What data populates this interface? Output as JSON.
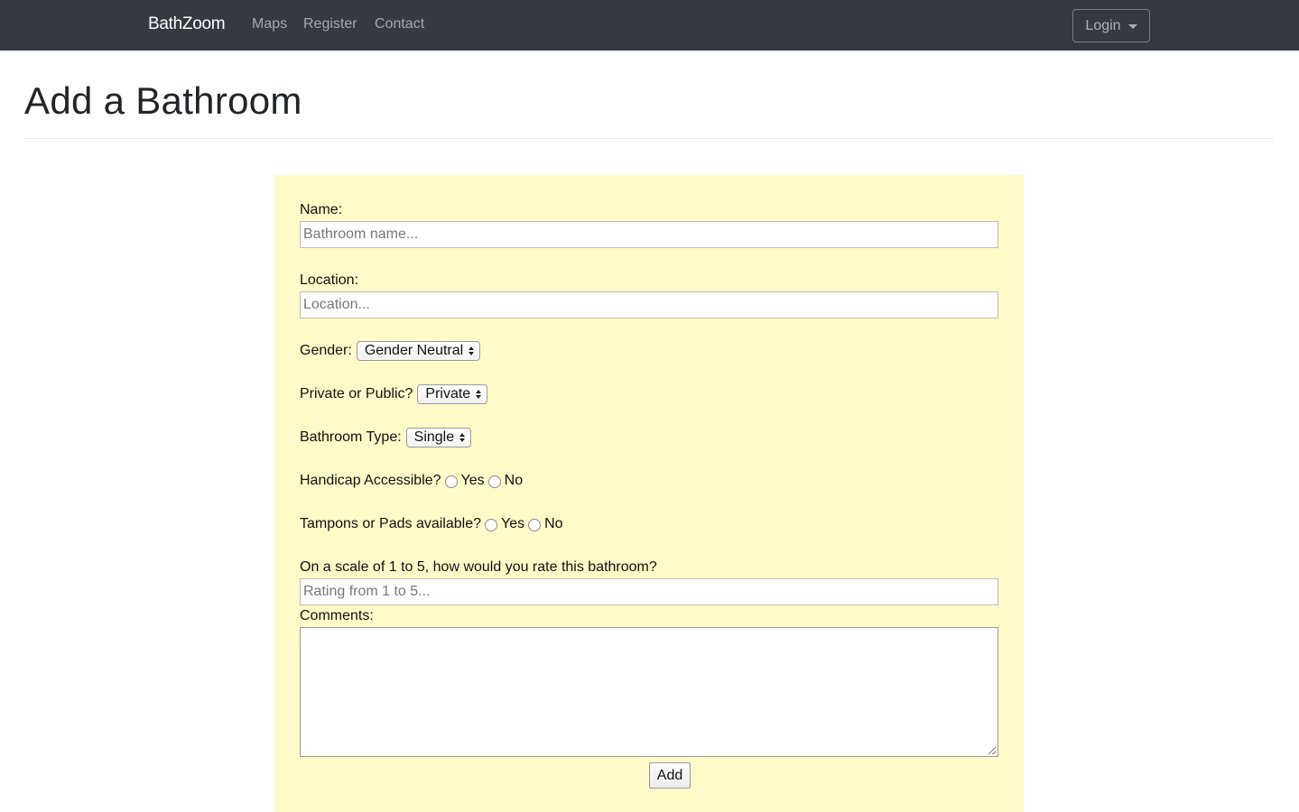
{
  "navbar": {
    "brand": "BathZoom",
    "links": [
      "Maps",
      "Register",
      "Contact"
    ],
    "login_label": "Login"
  },
  "page": {
    "title": "Add a Bathroom"
  },
  "form": {
    "name": {
      "label": "Name:",
      "placeholder": "Bathroom name...",
      "value": ""
    },
    "location": {
      "label": "Location:",
      "placeholder": "Location...",
      "value": ""
    },
    "gender": {
      "label": "Gender:",
      "selected": "Gender Neutral"
    },
    "privacy": {
      "label": "Private or Public?",
      "selected": "Private"
    },
    "bathroom_type": {
      "label": "Bathroom Type:",
      "selected": "Single"
    },
    "handicap": {
      "label": "Handicap Accessible?",
      "options": [
        "Yes",
        "No"
      ]
    },
    "tampons": {
      "label": "Tampons or Pads available?",
      "options": [
        "Yes",
        "No"
      ]
    },
    "rating": {
      "label": "On a scale of 1 to 5, how would you rate this bathroom?",
      "placeholder": "Rating from 1 to 5...",
      "value": ""
    },
    "comments": {
      "label": "Comments:",
      "value": ""
    },
    "submit_label": "Add"
  },
  "colors": {
    "navbar_bg": "#343a40",
    "form_bg": "#fffac8"
  }
}
